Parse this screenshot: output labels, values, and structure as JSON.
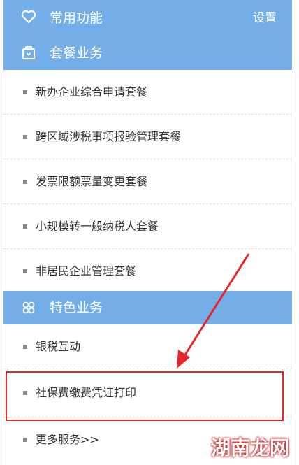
{
  "common": {
    "title": "常用功能",
    "settings": "设置"
  },
  "package_section": {
    "title": "套餐业务",
    "items": [
      "新办企业综合申请套餐",
      "跨区域涉税事项报验管理套餐",
      "发票限额票量变更套餐",
      "小规模转一般纳税人套餐",
      "非居民企业管理套餐"
    ]
  },
  "special_section": {
    "title": "特色业务",
    "items": [
      "银税互动",
      "社保费缴费凭证打印",
      "更多服务>>"
    ]
  },
  "watermark": "湖南龙网",
  "colors": {
    "header": "#73aee9",
    "highlight": "#e8262a"
  }
}
